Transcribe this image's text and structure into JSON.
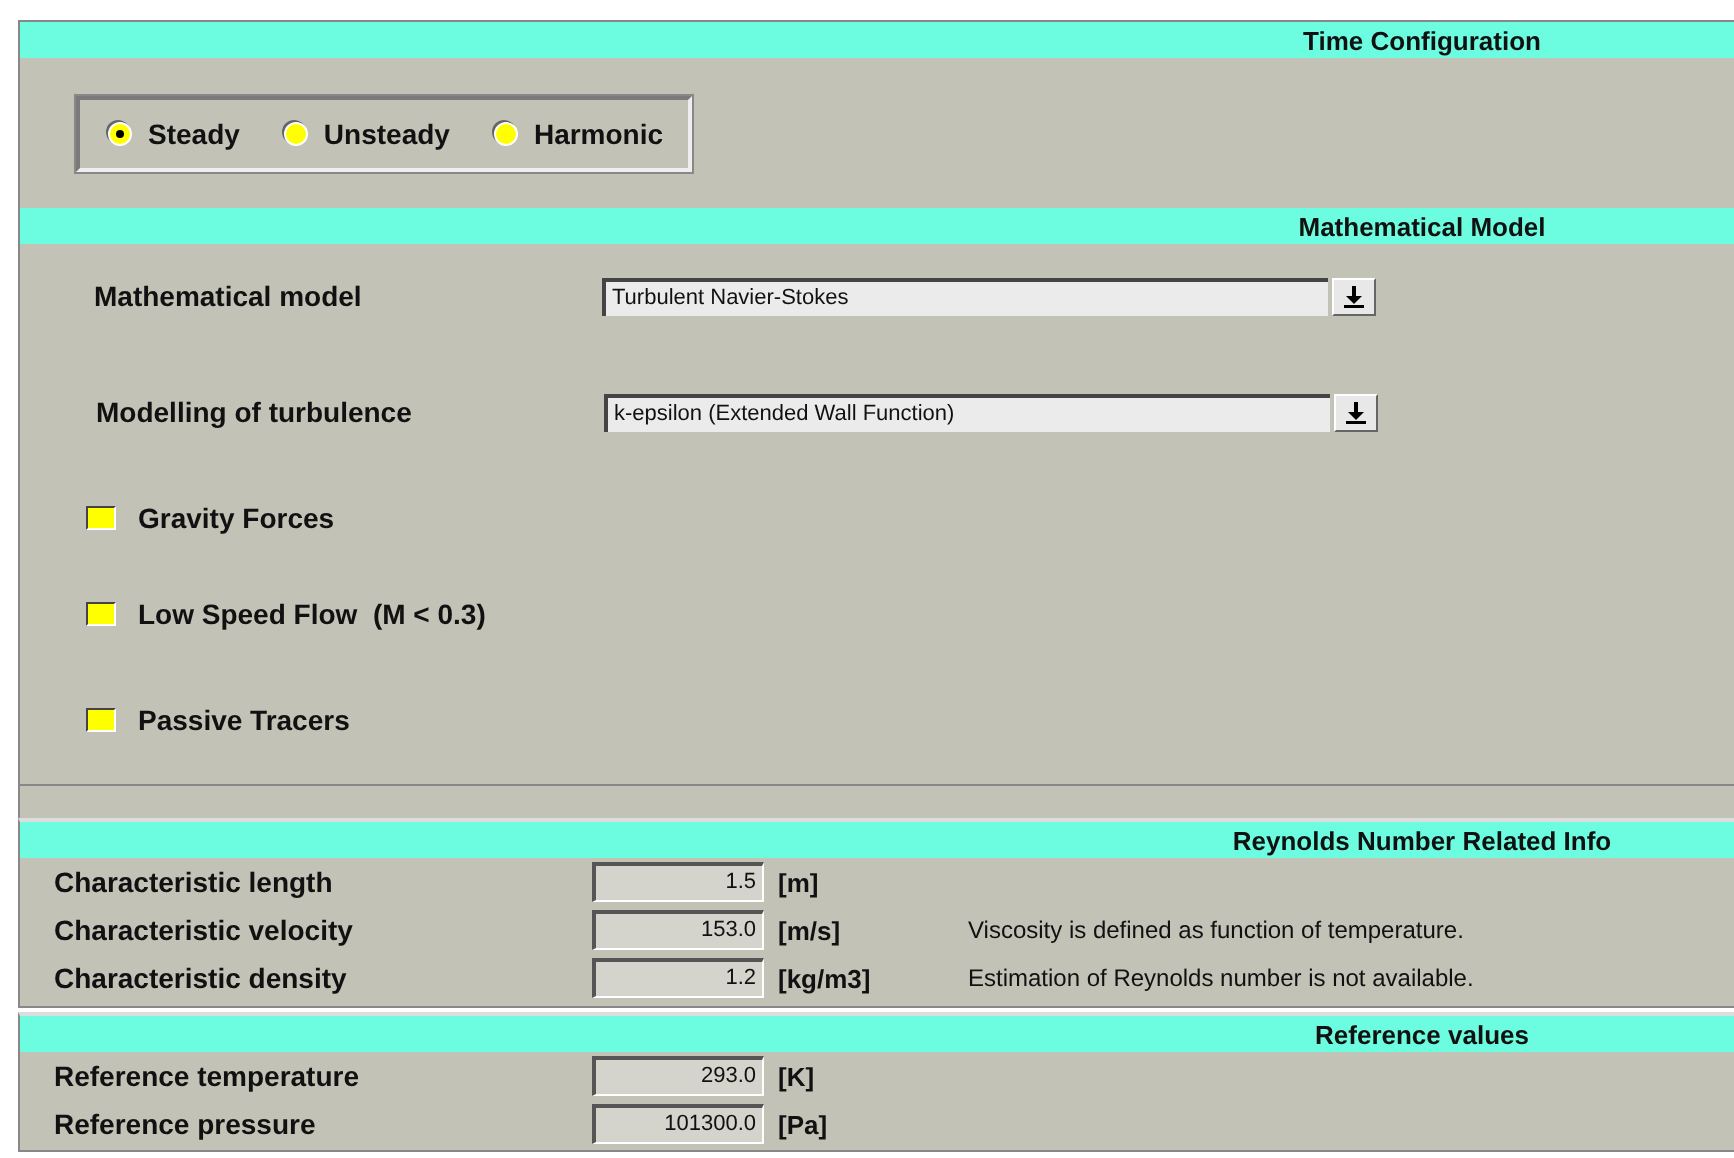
{
  "time_configuration": {
    "title": "Time Configuration",
    "options": [
      {
        "label": "Steady",
        "selected": true
      },
      {
        "label": "Unsteady",
        "selected": false
      },
      {
        "label": "Harmonic",
        "selected": false
      }
    ]
  },
  "mathematical_model": {
    "title": "Mathematical Model",
    "fields": [
      {
        "label": "Mathematical model",
        "value": "Turbulent Navier-Stokes"
      },
      {
        "label": "Modelling of turbulence",
        "value": "k-epsilon (Extended Wall Function)"
      }
    ],
    "options": [
      {
        "label": "Gravity Forces",
        "checked": false
      },
      {
        "label": "Low Speed Flow  (M < 0.3)",
        "checked": false
      },
      {
        "label": "Passive Tracers",
        "checked": false
      }
    ]
  },
  "reynolds_number_info": {
    "title": "Reynolds Number Related Info",
    "rows": [
      {
        "label": "Characteristic length",
        "value": "1.5",
        "unit": "[m]"
      },
      {
        "label": "Characteristic velocity",
        "value": "153.0",
        "unit": "[m/s]",
        "note": "Viscosity is defined as function of temperature."
      },
      {
        "label": "Characteristic density",
        "value": "1.2",
        "unit": "[kg/m3]",
        "note": "Estimation of Reynolds number is not available."
      }
    ]
  },
  "reference_values": {
    "title": "Reference values",
    "rows": [
      {
        "label": "Reference temperature",
        "value": "293.0",
        "unit": "[K]"
      },
      {
        "label": "Reference pressure",
        "value": "101300.0",
        "unit": "[Pa]"
      }
    ]
  }
}
